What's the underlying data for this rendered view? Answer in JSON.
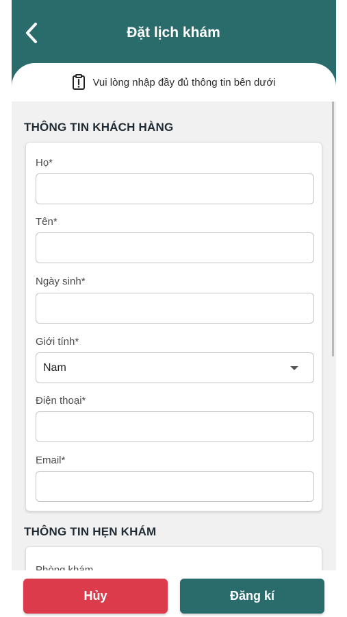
{
  "header": {
    "title": "Đặt lịch khám"
  },
  "notice": {
    "text": "Vui lòng nhập đầy đủ thông tin bên dưới"
  },
  "customer_section": {
    "title": "THÔNG TIN KHÁCH HÀNG",
    "fields": {
      "last_name": {
        "label": "Họ*",
        "value": ""
      },
      "first_name": {
        "label": "Tên*",
        "value": ""
      },
      "birthdate": {
        "label": "Ngày sinh*",
        "value": ""
      },
      "gender": {
        "label": "Giới tính*",
        "value": "Nam"
      },
      "phone": {
        "label": "Điện thoại*",
        "value": ""
      },
      "email": {
        "label": "Email*",
        "value": ""
      }
    }
  },
  "appointment_section": {
    "title": "THÔNG TIN HẸN KHÁM",
    "fields": {
      "clinic": {
        "label": "Phòng khám"
      }
    }
  },
  "footer": {
    "cancel_label": "Hủy",
    "submit_label": "Đăng kí"
  },
  "colors": {
    "primary": "#2a6b6b",
    "danger": "#dc3b4b",
    "background": "#f1f1f1"
  }
}
